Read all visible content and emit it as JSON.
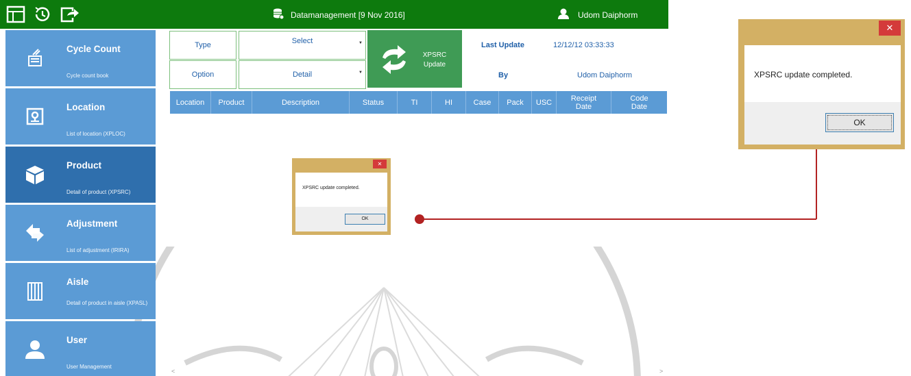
{
  "topbar": {
    "icons": [
      "grid-icon",
      "history-icon",
      "logout-icon"
    ],
    "title": "Datamanagement [9 Nov 2016]",
    "user": "Udom Daiphorm",
    "color": "#0d7a0d"
  },
  "sidebar": {
    "items": [
      {
        "title": "Cycle Count",
        "sub": "Cycle count book",
        "icon": "clipboard-icon"
      },
      {
        "title": "Location",
        "sub": "List of location (XPLOC)",
        "icon": "location-icon"
      },
      {
        "title": "Product",
        "sub": "Detail of product  (XPSRC)",
        "icon": "box-icon"
      },
      {
        "title": "Adjustment",
        "sub": "List of adjustment (IRIRA)",
        "icon": "arrows-icon"
      },
      {
        "title": "Aisle",
        "sub": "Detail of product in aisle (XPASL)",
        "icon": "aisle-icon"
      },
      {
        "title": "User",
        "sub": "User Management",
        "icon": "user-icon"
      }
    ],
    "color": "#5b9bd5",
    "active_color": "#2f6fad"
  },
  "controls": {
    "type_label": "Type",
    "type_value": "Select",
    "option_label": "Option",
    "option_value": "Detail",
    "update_label_1": "XPSRC",
    "update_label_2": "Update",
    "last_update_label": "Last Update",
    "last_update_value": "12/12/12  03:33:33",
    "by_label": "By",
    "by_value": "Udom Daiphorm"
  },
  "table": {
    "columns": [
      {
        "label": "Location"
      },
      {
        "label": "Product"
      },
      {
        "label": "Description"
      },
      {
        "label": "Status"
      },
      {
        "label": "TI"
      },
      {
        "label": "HI"
      },
      {
        "label": "Case"
      },
      {
        "label": "Pack"
      },
      {
        "label": "USC"
      },
      {
        "label": "Receipt Date"
      },
      {
        "label": "Code Date"
      }
    ]
  },
  "dialog": {
    "message": "XPSRC update completed.",
    "ok": "OK",
    "close": "✕"
  },
  "colors": {
    "dialog_frame": "#d3b064",
    "callout": "#b22222",
    "button_green": "#3f9b55"
  }
}
